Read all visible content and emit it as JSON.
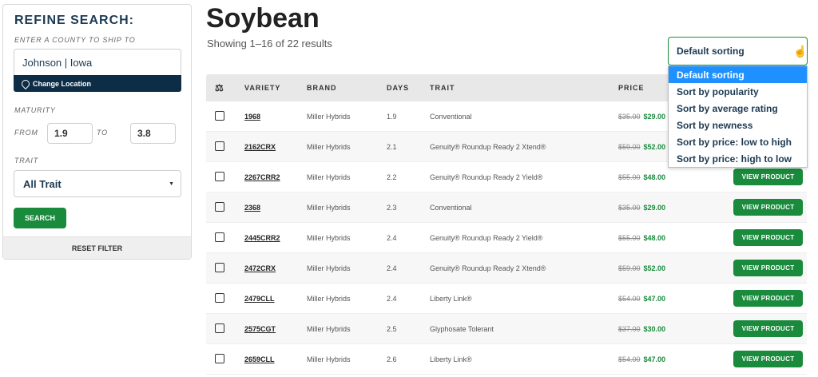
{
  "sidebar": {
    "title": "REFINE SEARCH:",
    "county_label": "ENTER A COUNTY TO SHIP TO",
    "county_value": "Johnson | Iowa",
    "change_location": "Change Location",
    "maturity_label": "MATURITY",
    "from_label": "FROM",
    "to_label": "TO",
    "from_value": "1.9",
    "to_value": "3.8",
    "trait_label": "TRAIT",
    "trait_value": "All Trait",
    "search_button": "SEARCH",
    "reset_button": "RESET FILTER"
  },
  "main": {
    "title": "Soybean",
    "results_text": "Showing 1–16 of 22 results"
  },
  "sort": {
    "selected": "Default sorting",
    "options": [
      "Default sorting",
      "Sort by popularity",
      "Sort by average rating",
      "Sort by newness",
      "Sort by price: low to high",
      "Sort by price: high to low"
    ]
  },
  "table": {
    "headers": {
      "variety": "VARIETY",
      "brand": "BRAND",
      "days": "DAYS",
      "trait": "TRAIT",
      "price": "PRICE"
    },
    "view_label": "VIEW PRODUCT",
    "rows": [
      {
        "variety": "1968",
        "brand": "Miller Hybrids",
        "days": "1.9",
        "trait": "Conventional",
        "old_price": "$35.00",
        "price": "$29.00",
        "show_button": false
      },
      {
        "variety": "2162CRX",
        "brand": "Miller Hybrids",
        "days": "2.1",
        "trait": "Genuity® Roundup Ready 2 Xtend®",
        "old_price": "$59.00",
        "price": "$52.00",
        "show_button": false
      },
      {
        "variety": "2267CRR2",
        "brand": "Miller Hybrids",
        "days": "2.2",
        "trait": "Genuity® Roundup Ready 2 Yield®",
        "old_price": "$55.00",
        "price": "$48.00",
        "show_button": true
      },
      {
        "variety": "2368",
        "brand": "Miller Hybrids",
        "days": "2.3",
        "trait": "Conventional",
        "old_price": "$35.00",
        "price": "$29.00",
        "show_button": true
      },
      {
        "variety": "2445CRR2",
        "brand": "Miller Hybrids",
        "days": "2.4",
        "trait": "Genuity® Roundup Ready 2 Yield®",
        "old_price": "$55.00",
        "price": "$48.00",
        "show_button": true
      },
      {
        "variety": "2472CRX",
        "brand": "Miller Hybrids",
        "days": "2.4",
        "trait": "Genuity® Roundup Ready 2 Xtend®",
        "old_price": "$59.00",
        "price": "$52.00",
        "show_button": true
      },
      {
        "variety": "2479CLL",
        "brand": "Miller Hybrids",
        "days": "2.4",
        "trait": "Liberty Link®",
        "old_price": "$54.00",
        "price": "$47.00",
        "show_button": true
      },
      {
        "variety": "2575CGT",
        "brand": "Miller Hybrids",
        "days": "2.5",
        "trait": "Glyphosate Tolerant",
        "old_price": "$37.00",
        "price": "$30.00",
        "show_button": true
      },
      {
        "variety": "2659CLL",
        "brand": "Miller Hybrids",
        "days": "2.6",
        "trait": "Liberty Link®",
        "old_price": "$54.00",
        "price": "$47.00",
        "show_button": true
      }
    ]
  },
  "icons": {
    "compare": "scale-icon",
    "location": "map-pin-icon",
    "cursor": "hand-pointer-icon"
  },
  "colors": {
    "accent_green": "#1a8a3c",
    "navy": "#0d2d47",
    "highlight_blue": "#1e90ff"
  }
}
